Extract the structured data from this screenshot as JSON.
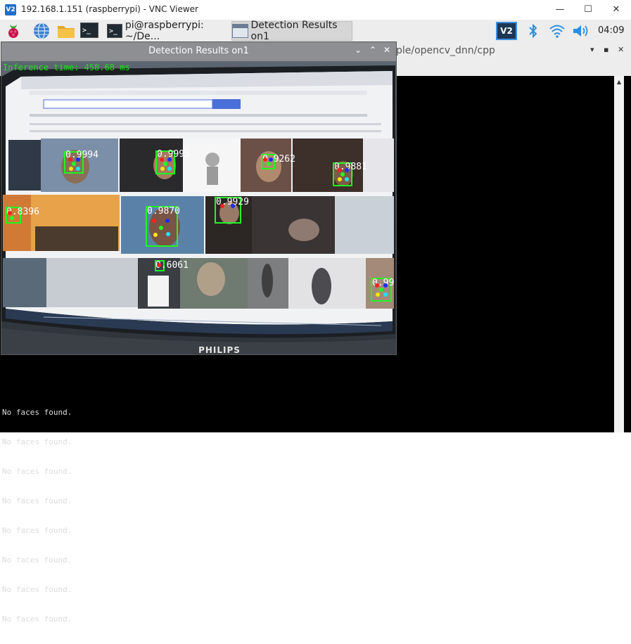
{
  "vnc": {
    "logo": "V2",
    "title": "192.168.1.151 (raspberrypi) - VNC Viewer",
    "minimize": "—",
    "maximize": "☐",
    "close": "✕"
  },
  "taskbar": {
    "tasks": [
      {
        "label": ""
      },
      {
        "label": "pi@raspberrypi: ~/De..."
      },
      {
        "label": "Detection Results on1"
      }
    ],
    "icons": [
      "raspberry-menu-icon",
      "web-browser-icon",
      "file-manager-icon",
      "terminal-icon",
      "vnc-server-icon",
      "bluetooth-icon",
      "wifi-icon",
      "volume-icon"
    ],
    "vnc_tray_logo": "V2",
    "clock": "04:09"
  },
  "terminal": {
    "path_partial": "ple/opencv_dnn/cpp",
    "min": "▾",
    "max": "▪",
    "close": "✕",
    "lines": [
      "No faces found.",
      "No faces found.",
      "No faces found.",
      "No faces found.",
      "No faces found.",
      "No faces found.",
      "No faces found.",
      "No faces found."
    ]
  },
  "detection": {
    "title": "Detection Results on1",
    "ctrl_min": "⌄",
    "ctrl_max": "⌃",
    "ctrl_close": "✕",
    "inference": "Inference time: 458.68 ms",
    "brand": "PHILIPS",
    "faces": [
      {
        "score": "0.9994"
      },
      {
        "score": "0.9995"
      },
      {
        "score": "0.9262"
      },
      {
        "score": "0.9881"
      },
      {
        "score": "0.8396"
      },
      {
        "score": "0.9870"
      },
      {
        "score": "0.9929"
      },
      {
        "score": "0.6061"
      },
      {
        "score": "0.99"
      }
    ]
  },
  "colors": {
    "box": "#21f521",
    "lm_red": "#ff2020",
    "lm_blue": "#1c2dff",
    "lm_green": "#22ff22",
    "lm_yellow": "#ffe700",
    "lm_cyan": "#19e5ff"
  }
}
